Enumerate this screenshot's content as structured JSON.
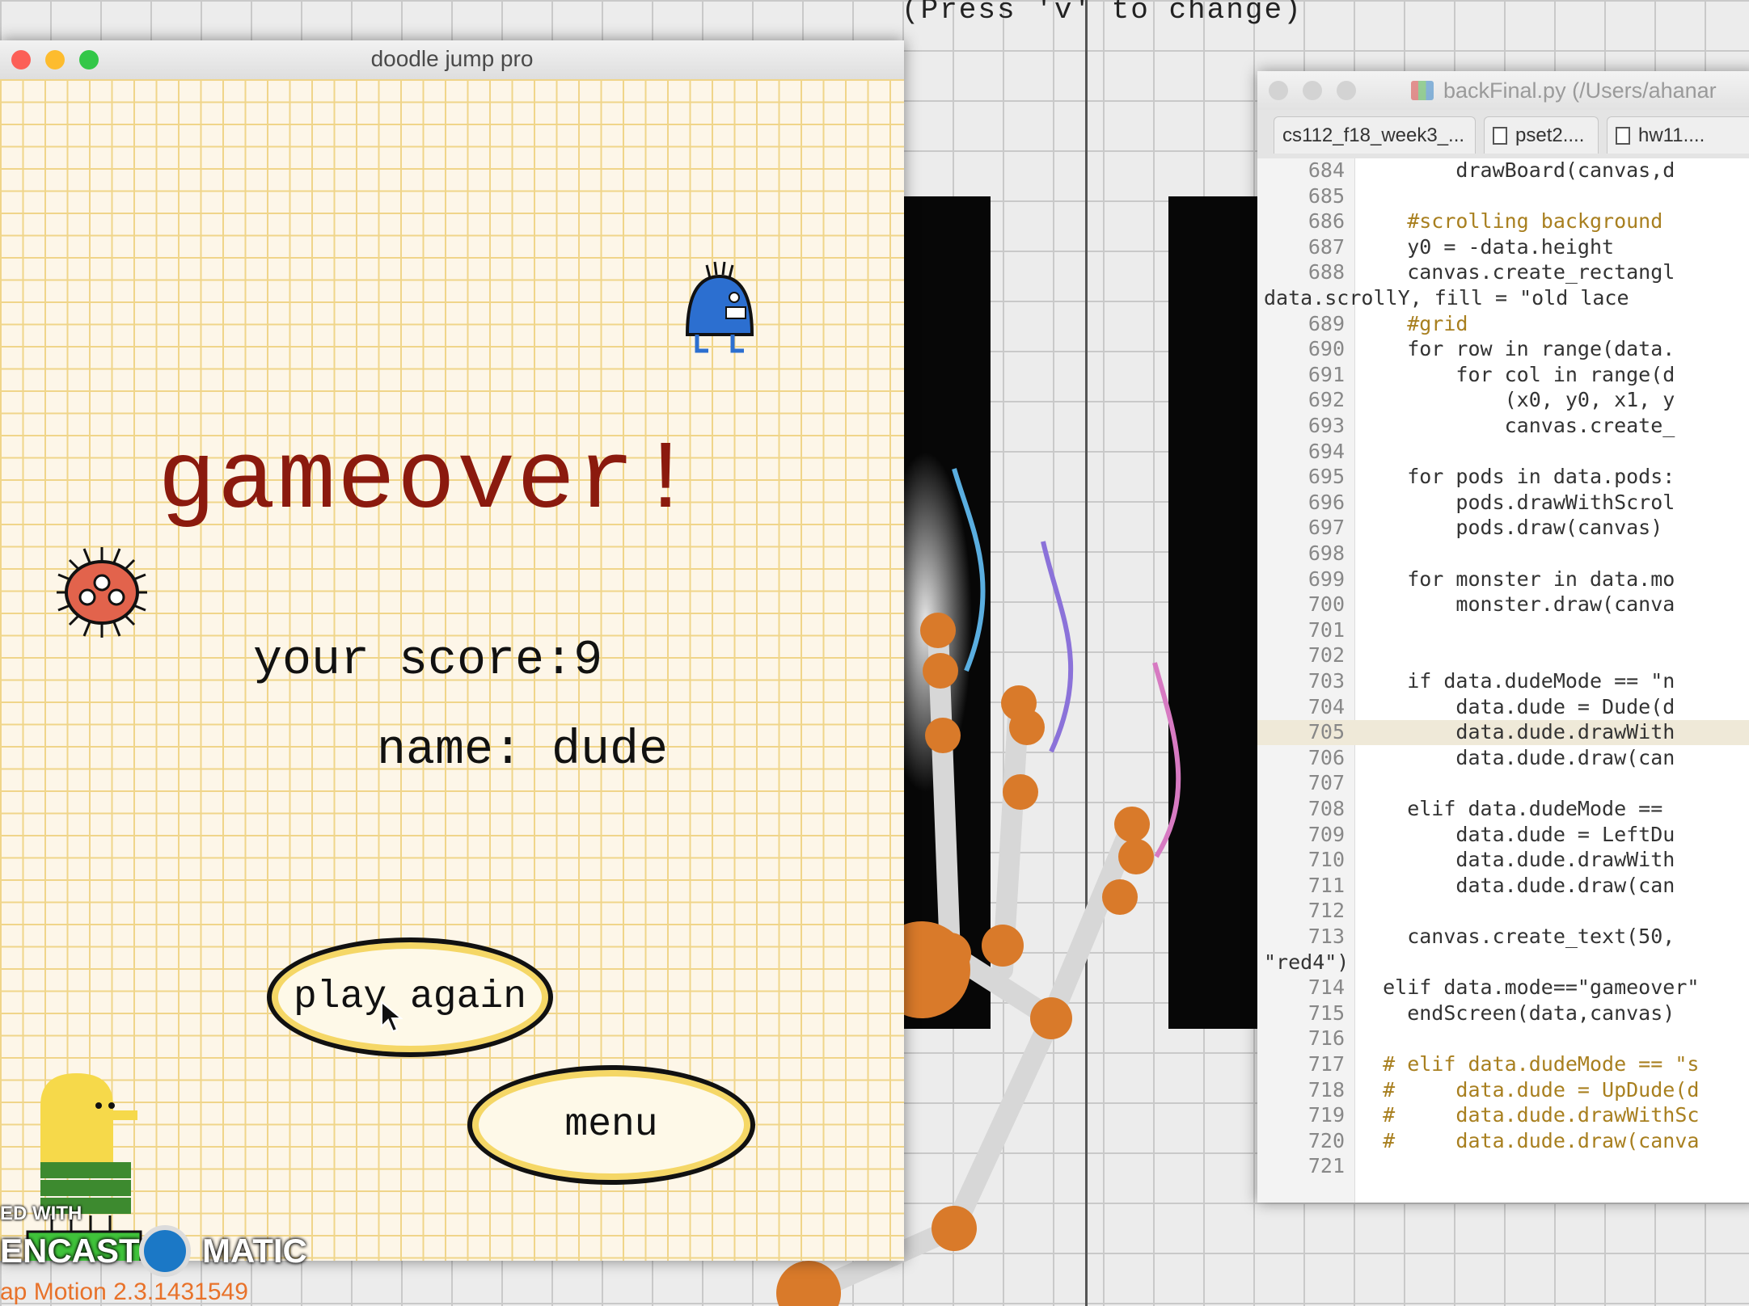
{
  "viewer": {
    "caption": "(Press 'v' to change)"
  },
  "game_window": {
    "title": "doodle jump pro",
    "gameover_text": "gameover!",
    "score_text": "your score:9",
    "name_text": "name: dude",
    "play_again_label": "play again",
    "menu_label": "menu",
    "colors": {
      "title_red": "#8b1a0e",
      "grid_line": "#f0d58a",
      "paper": "#fdf6e8",
      "button_ring": "#f5d766"
    }
  },
  "watermark": {
    "recorded": "ED WITH",
    "brand_left": "ENCAST",
    "brand_right": "MATIC",
    "footer": "ap Motion 2.3.1431549"
  },
  "editor": {
    "title": "backFinal.py (/Users/ahanar",
    "tabs": [
      "cs112_f18_week3_...",
      "pset2....",
      "hw11...."
    ],
    "lines": [
      {
        "n": "684",
        "t": "        drawBoard(canvas,d"
      },
      {
        "n": "685",
        "t": ""
      },
      {
        "n": "686",
        "t": "    #scrolling background",
        "cls": "cm"
      },
      {
        "n": "687",
        "t": "    y0 = -data.height"
      },
      {
        "n": "688",
        "t": "    canvas.create_rectangl"
      },
      {
        "n": "",
        "t": "data.scrollY, fill = \"old lace",
        "wrap": true
      },
      {
        "n": "689",
        "t": "    #grid",
        "cls": "cm"
      },
      {
        "n": "690",
        "t": "    for row in range(data."
      },
      {
        "n": "691",
        "t": "        for col in range(d"
      },
      {
        "n": "692",
        "t": "            (x0, y0, x1, y"
      },
      {
        "n": "693",
        "t": "            canvas.create_"
      },
      {
        "n": "694",
        "t": ""
      },
      {
        "n": "695",
        "t": "    for pods in data.pods:"
      },
      {
        "n": "696",
        "t": "        pods.drawWithScrol"
      },
      {
        "n": "697",
        "t": "        pods.draw(canvas)"
      },
      {
        "n": "698",
        "t": ""
      },
      {
        "n": "699",
        "t": "    for monster in data.mo"
      },
      {
        "n": "700",
        "t": "        monster.draw(canva"
      },
      {
        "n": "701",
        "t": ""
      },
      {
        "n": "702",
        "t": ""
      },
      {
        "n": "703",
        "t": "    if data.dudeMode == \"n"
      },
      {
        "n": "704",
        "t": "        data.dude = Dude(d"
      },
      {
        "n": "705",
        "t": "        data.dude.drawWith",
        "hl": true
      },
      {
        "n": "706",
        "t": "        data.dude.draw(can"
      },
      {
        "n": "707",
        "t": ""
      },
      {
        "n": "708",
        "t": "    elif data.dudeMode =="
      },
      {
        "n": "709",
        "t": "        data.dude = LeftDu"
      },
      {
        "n": "710",
        "t": "        data.dude.drawWith"
      },
      {
        "n": "711",
        "t": "        data.dude.draw(can"
      },
      {
        "n": "712",
        "t": ""
      },
      {
        "n": "713",
        "t": "    canvas.create_text(50,"
      },
      {
        "n": "",
        "t": "\"red4\")",
        "wrap": true
      },
      {
        "n": "714",
        "t": "  elif data.mode==\"gameover\""
      },
      {
        "n": "715",
        "t": "    endScreen(data,canvas)"
      },
      {
        "n": "716",
        "t": ""
      },
      {
        "n": "717",
        "t": "  # elif data.dudeMode == \"s",
        "cls": "cm"
      },
      {
        "n": "718",
        "t": "  #     data.dude = UpDude(d",
        "cls": "cm"
      },
      {
        "n": "719",
        "t": "  #     data.dude.drawWithSc",
        "cls": "cm"
      },
      {
        "n": "720",
        "t": "  #     data.dude.draw(canva",
        "cls": "cm"
      },
      {
        "n": "721",
        "t": ""
      }
    ]
  }
}
